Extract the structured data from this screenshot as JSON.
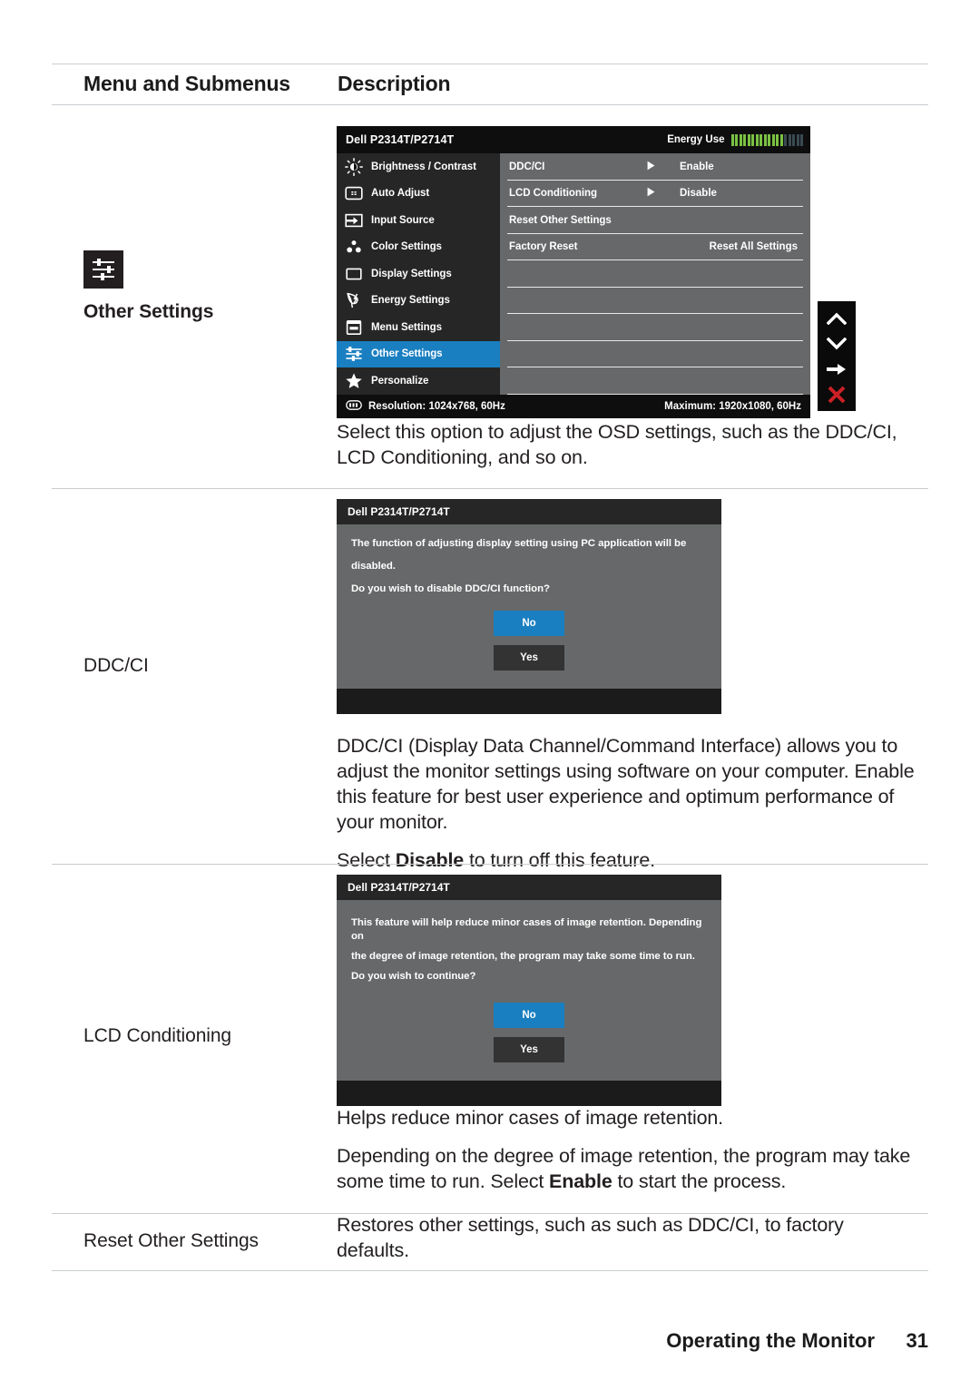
{
  "table": {
    "headers": {
      "menu_col": "Menu and Submenus",
      "description_col": "Description"
    }
  },
  "rows": {
    "other_settings": {
      "label": "Other Settings",
      "icon": "sliders-icon",
      "description_lines": [
        "Select this option to adjust the OSD settings, such as the DDC/CI, LCD Conditioning, and so on."
      ]
    },
    "ddcci": {
      "label": "DDC/CI",
      "description_lines": [
        "DDC/CI (Display Data Channel/Command Interface) allows you to adjust the monitor settings using software on your computer. Enable this feature for best user experience and optimum performance of your monitor."
      ],
      "select_line_prefix": "Select ",
      "select_line_bold": "Disable",
      "select_line_suffix": " to turn off this feature."
    },
    "lcd_conditioning": {
      "label": "LCD Conditioning",
      "description_line_1": "Helps reduce minor cases of image retention.",
      "description_line_2_prefix": "Depending on the degree of image retention, the program may take some time to run. Select ",
      "description_line_2_bold": "Enable",
      "description_line_2_suffix": " to start the process."
    },
    "reset_other_settings": {
      "label": "Reset Other Settings",
      "description": "Restores other settings, such as such as DDC/CI, to factory defaults."
    }
  },
  "osd": {
    "title": "Dell P2314T/P2714T",
    "energy_label": "Energy Use",
    "energy_bars_on": 13,
    "energy_bars_off": 5,
    "accent_color": "#1a7fc1",
    "energy_on_color": "#7ac143",
    "energy_off_color": "#3a4a52",
    "menu_items": [
      {
        "label": "Brightness / Contrast",
        "icon": "brightness-icon",
        "active": false
      },
      {
        "label": "Auto Adjust",
        "icon": "auto-adjust-icon",
        "active": false
      },
      {
        "label": "Input Source",
        "icon": "input-source-icon",
        "active": false
      },
      {
        "label": "Color Settings",
        "icon": "color-settings-icon",
        "active": false
      },
      {
        "label": "Display Settings",
        "icon": "display-settings-icon",
        "active": false
      },
      {
        "label": "Energy Settings",
        "icon": "energy-settings-icon",
        "active": false
      },
      {
        "label": "Menu Settings",
        "icon": "menu-settings-icon",
        "active": false
      },
      {
        "label": "Other Settings",
        "icon": "other-settings-icon",
        "active": true
      },
      {
        "label": "Personalize",
        "icon": "personalize-star-icon",
        "active": false
      }
    ],
    "submenu_items": [
      {
        "name": "DDC/CI",
        "arrow": true,
        "value": "Enable",
        "value_align": "left"
      },
      {
        "name": "LCD Conditioning",
        "arrow": true,
        "value": "Disable",
        "value_align": "left"
      },
      {
        "name": "Reset Other Settings",
        "arrow": false,
        "value": "",
        "value_align": "left"
      },
      {
        "name": "Factory Reset",
        "arrow": false,
        "value": "Reset All Settings",
        "value_align": "right"
      },
      {
        "name": "",
        "arrow": false,
        "value": "",
        "value_align": "left"
      },
      {
        "name": "",
        "arrow": false,
        "value": "",
        "value_align": "left"
      },
      {
        "name": "",
        "arrow": false,
        "value": "",
        "value_align": "left"
      },
      {
        "name": "",
        "arrow": false,
        "value": "",
        "value_align": "left"
      },
      {
        "name": "",
        "arrow": false,
        "value": "",
        "value_align": "left"
      }
    ],
    "resolution_label": "Resolution:  1024x768, 60Hz",
    "maximum_label": "Maximum: 1920x1080, 60Hz",
    "nav_buttons": [
      {
        "icon": "chevron-up-icon"
      },
      {
        "icon": "chevron-down-icon"
      },
      {
        "icon": "arrow-right-icon"
      },
      {
        "icon": "close-x-icon"
      }
    ]
  },
  "ddcci_dialog": {
    "title": "Dell P2314T/P2714T",
    "line1": "The function of adjusting display setting using PC application will be",
    "line2": "disabled.",
    "line3": "Do you wish to disable DDC/CI function?",
    "btn_no": "No",
    "btn_yes": "Yes"
  },
  "lcd_dialog": {
    "title": "Dell P2314T/P2714T",
    "line1": "This feature will help reduce minor cases of image retention. Depending on",
    "line2": "the degree of image retention, the program may take some time to run.",
    "line3": "Do you wish to continue?",
    "btn_no": "No",
    "btn_yes": "Yes"
  },
  "footer": {
    "title": "Operating the Monitor",
    "page_number": "31"
  }
}
